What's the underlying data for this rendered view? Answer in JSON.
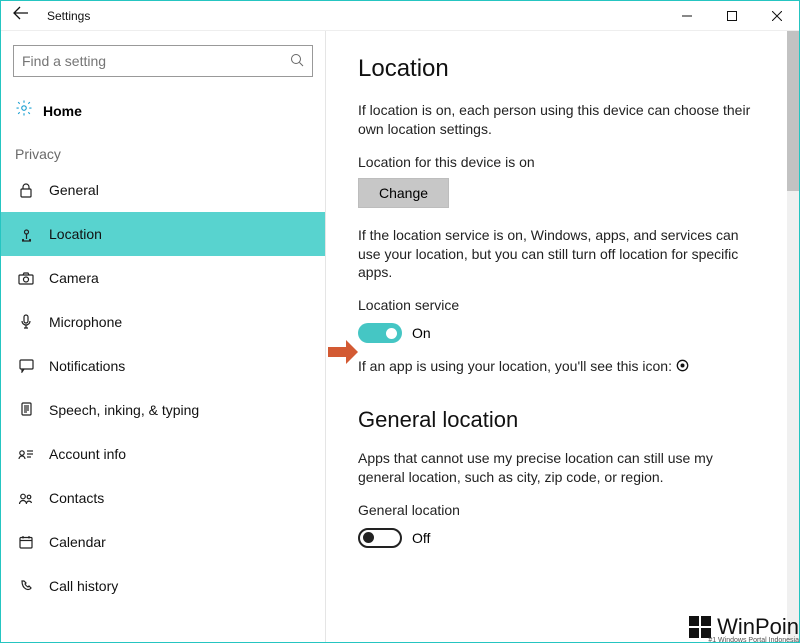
{
  "window": {
    "title": "Settings"
  },
  "sidebar": {
    "search_placeholder": "Find a setting",
    "home_label": "Home",
    "group_label": "Privacy",
    "items": [
      {
        "icon": "lock-icon",
        "label": "General"
      },
      {
        "icon": "location-pin-icon",
        "label": "Location"
      },
      {
        "icon": "camera-icon",
        "label": "Camera"
      },
      {
        "icon": "microphone-icon",
        "label": "Microphone"
      },
      {
        "icon": "notifications-icon",
        "label": "Notifications"
      },
      {
        "icon": "speech-icon",
        "label": "Speech, inking, & typing"
      },
      {
        "icon": "account-info-icon",
        "label": "Account info"
      },
      {
        "icon": "contacts-icon",
        "label": "Contacts"
      },
      {
        "icon": "calendar-icon",
        "label": "Calendar"
      },
      {
        "icon": "call-history-icon",
        "label": "Call history"
      }
    ]
  },
  "main": {
    "heading": "Location",
    "intro": "If location is on, each person using this device can choose their own location settings.",
    "device_status_label": "Location for this device is on",
    "change_button": "Change",
    "service_desc": "If the location service is on, Windows, apps, and services can use your location, but you can still turn off location for specific apps.",
    "service_label": "Location service",
    "service_toggle_state": "On",
    "icon_note": "If an app is using your location, you'll see this icon:",
    "general_heading": "General location",
    "general_desc": "Apps that cannot use my precise location can still use my general location, such as city, zip code, or region.",
    "general_label": "General location",
    "general_toggle_state": "Off"
  },
  "watermark": {
    "name": "WinPoin",
    "sub": "#1 Windows Portal Indonesia"
  }
}
